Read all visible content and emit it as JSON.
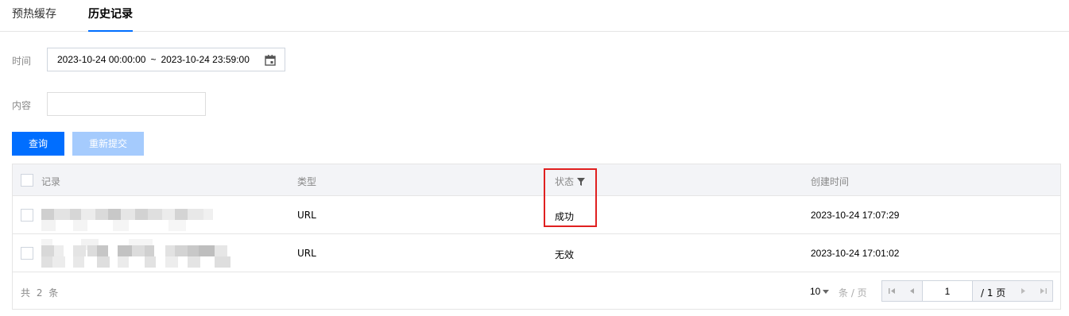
{
  "tabs": [
    {
      "label": "预热缓存"
    },
    {
      "label": "历史记录"
    }
  ],
  "filters": {
    "time_label": "时间",
    "date_start": "2023-10-24 00:00:00",
    "date_sep": "~",
    "date_end": "2023-10-24 23:59:00",
    "content_label": "内容",
    "content_value": ""
  },
  "buttons": {
    "query": "查询",
    "resubmit": "重新提交"
  },
  "table": {
    "columns": {
      "record": "记录",
      "type": "类型",
      "status": "状态",
      "created": "创建时间"
    },
    "rows": [
      {
        "record": "",
        "type": "URL",
        "status": "成功",
        "created": "2023-10-24 17:07:29"
      },
      {
        "record": "",
        "type": "URL",
        "status": "无效",
        "created": "2023-10-24 17:01:02"
      }
    ]
  },
  "footer": {
    "total": "共 2 条",
    "page_size": "10",
    "per_page": "条 / 页",
    "current_page": "1",
    "total_pages": "/ 1 页"
  },
  "colors": {
    "primary": "#006eff",
    "disabled": "#a5cbfd",
    "highlight": "#e02020"
  },
  "icons": [
    "calendar-icon",
    "filter-icon",
    "first-page-icon",
    "prev-page-icon",
    "next-page-icon",
    "last-page-icon"
  ]
}
